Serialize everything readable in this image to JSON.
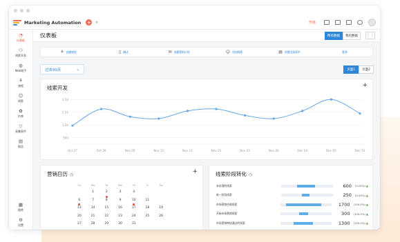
{
  "app": {
    "title": "Marketing Automation",
    "upgrade": "升级"
  },
  "sidebar": {
    "items": [
      {
        "label": "仪表板",
        "icon": "dashboard-icon",
        "glyph": "◔"
      },
      {
        "label": "线索开发",
        "icon": "leads-icon",
        "glyph": "⚇"
      },
      {
        "label": "Web助手",
        "icon": "web-icon",
        "glyph": "◍"
      },
      {
        "label": "旅程",
        "icon": "journey-icon",
        "glyph": "⚘"
      },
      {
        "label": "线索",
        "icon": "lead-icon",
        "glyph": "☺"
      },
      {
        "label": "约束",
        "icon": "segment-icon",
        "glyph": "✿"
      },
      {
        "label": "采集条件",
        "icon": "filter-icon",
        "glyph": "▽"
      },
      {
        "label": "报告",
        "icon": "report-icon",
        "glyph": "▤"
      }
    ],
    "bottom": [
      {
        "label": "图库",
        "icon": "library-icon",
        "glyph": "▦"
      },
      {
        "label": "设置",
        "icon": "settings-icon",
        "glyph": "⚙"
      }
    ]
  },
  "header": {
    "title": "仪表板",
    "toggle": [
      "所有数据",
      "我的数据"
    ],
    "grid": "⋮⋮"
  },
  "quick_actions": [
    {
      "label": "创建旅程",
      "icon": "journey-create-icon",
      "glyph": "⚘"
    },
    {
      "label": "触达",
      "icon": "contact-icon",
      "glyph": "▯"
    },
    {
      "label": "创建营销计划",
      "icon": "email-icon",
      "glyph": "✉"
    },
    {
      "label": "添加线索",
      "icon": "add-lead-icon",
      "glyph": "☺"
    },
    {
      "label": "创建活跃条件",
      "icon": "form-icon",
      "glyph": "▤"
    },
    {
      "label": "更多",
      "icon": "more-icon",
      "glyph": ""
    }
  ],
  "period": {
    "value": "过去90天"
  },
  "pager": [
    "页面1",
    "页面2"
  ],
  "lead_chart": {
    "title": "线索开发",
    "add": "+",
    "chart_data": {
      "type": "line",
      "categories": [
        "Oct 27",
        "Oct 29",
        "Nov 05",
        "Nov 12",
        "Nov 13",
        "Nov 21",
        "Nov 23",
        "Nov 30",
        "Dec 04",
        "Dec 05",
        "Dec 10"
      ],
      "y_ticks": [
        "3.5k",
        "2.5k",
        "1.5k",
        "500"
      ],
      "points": [
        {
          "x": "Oct 27",
          "y": 1450
        },
        {
          "x": "Oct 29",
          "y": 2750
        },
        {
          "x": "Nov 05",
          "y": 2150
        },
        {
          "x": "Nov 12",
          "y": 2000
        },
        {
          "x": "Nov 13",
          "y": 2600
        },
        {
          "x": "Nov 21",
          "y": 2750
        },
        {
          "x": "Nov 23",
          "y": 2250
        },
        {
          "x": "Nov 30",
          "y": 2000
        },
        {
          "x": "Dec 04",
          "y": 2600
        },
        {
          "x": "Dec 05",
          "y": 3500
        },
        {
          "x": "Dec 10",
          "y": 2400
        }
      ],
      "ylim": [
        0,
        4000
      ],
      "grid": true
    }
  },
  "calendar": {
    "title": "营销日历",
    "add": "+",
    "days_header": [
      "Su",
      "Mo",
      "Tu",
      "We",
      "Th",
      "Fr",
      "Sa"
    ],
    "cells": [
      {
        "d": "",
        "m": false
      },
      {
        "d": "1",
        "m": false
      },
      {
        "d": "2",
        "m": true
      },
      {
        "d": "3",
        "m": false
      },
      {
        "d": "4",
        "m": false
      },
      {
        "d": "",
        "m": false
      },
      {
        "d": "",
        "m": false
      },
      {
        "d": "6",
        "m": true
      },
      {
        "d": "7",
        "m": false
      },
      {
        "d": "8",
        "m": false
      },
      {
        "d": "9",
        "m": false
      },
      {
        "d": "10",
        "m": true
      },
      {
        "d": "11",
        "m": false
      },
      {
        "d": "",
        "m": false
      },
      {
        "d": "13",
        "m": false
      },
      {
        "d": "14",
        "m": false
      },
      {
        "d": "15",
        "m": false
      },
      {
        "d": "16",
        "m": false
      },
      {
        "d": "17",
        "m": false
      },
      {
        "d": "18",
        "m": false
      },
      {
        "d": "19",
        "m": false
      },
      {
        "d": "20",
        "m": false
      },
      {
        "d": "21",
        "m": false
      },
      {
        "d": "22",
        "m": false
      },
      {
        "d": "23",
        "m": false
      },
      {
        "d": "24",
        "m": false
      },
      {
        "d": "25",
        "m": false
      },
      {
        "d": "26",
        "m": false
      },
      {
        "d": "27",
        "m": false
      },
      {
        "d": "28",
        "m": false
      },
      {
        "d": "29",
        "m": false
      },
      {
        "d": "30",
        "m": false
      },
      {
        "d": "31",
        "m": false
      },
      {
        "d": "",
        "m": false
      },
      {
        "d": "",
        "m": false
      }
    ]
  },
  "conversion": {
    "title": "线索阶段转化",
    "rows": [
      {
        "name": "未处理的线索",
        "value": "600",
        "pct": "(0.05%)",
        "fill": 0.35,
        "offset": 0.3
      },
      {
        "name": "新一阶段线索",
        "value": "250",
        "pct": "(0.05%)",
        "fill": 0.15,
        "offset": 0.4
      },
      {
        "name": "市场营销合格线索",
        "value": "1700",
        "pct": "(100.0%)",
        "fill": 0.7,
        "offset": 0.1
      },
      {
        "name": "开始市场营销线索",
        "value": "300",
        "pct": "(100.0%)",
        "fill": 0.18,
        "offset": 0.36
      },
      {
        "name": "市场营销审核通过的线索",
        "value": "1300",
        "pct": "(100.0%)",
        "fill": 0.38,
        "offset": 0.25
      }
    ]
  },
  "colors": {
    "accent": "#2f87d8",
    "brand": "#ef6a4f",
    "line": "#64a8e8",
    "marker": "#e24a3b"
  }
}
